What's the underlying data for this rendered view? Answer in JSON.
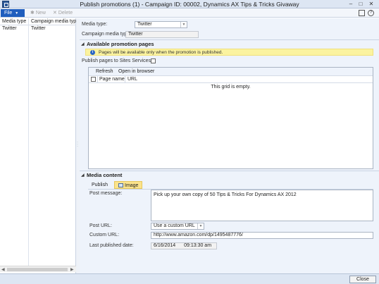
{
  "window": {
    "title": "Publish promotions (1) - Campaign ID: 00002, Dynamics AX Tips & Tricks Givaway",
    "min_glyph": "–",
    "max_glyph": "□",
    "close_glyph": "✕"
  },
  "toolbar": {
    "file_label": "File",
    "new_label": "New",
    "delete_label": "Delete",
    "help_glyph": "?"
  },
  "list": {
    "columns": [
      "Media type",
      "Campaign media type"
    ],
    "rows": [
      [
        "Twitter",
        "Twitter"
      ]
    ]
  },
  "form": {
    "media_type_label": "Media type:",
    "media_type_value": "Twitter",
    "campaign_media_type_label": "Campaign media type:",
    "campaign_media_type_value": "Twitter"
  },
  "promotion_pages": {
    "title": "Available promotion pages",
    "info_message": "Pages will be available only when the promotion is published.",
    "publish_to_sites_label": "Publish pages to Sites Services:",
    "publish_to_sites_checked": false,
    "refresh_label": "Refresh",
    "open_browser_label": "Open in browser",
    "grid_columns": [
      "Page name",
      "URL"
    ],
    "empty_message": "This grid is empty."
  },
  "media_content": {
    "title": "Media content",
    "tabs": [
      "Publish",
      "Image"
    ],
    "active_tab": "Image",
    "post_message_label": "Post message:",
    "post_message_value": "Pick up your own copy of 50 Tips & Tricks For Dynamics AX 2012",
    "post_url_label": "Post URL:",
    "post_url_value": "Use a custom URL",
    "custom_url_label": "Custom URL:",
    "custom_url_value": "http://www.amazon.com/dp/1495487776/",
    "last_published_label": "Last published date:",
    "last_published_date": "6/16/2014",
    "last_published_time": "09:13:30 am"
  },
  "footer": {
    "close_label": "Close"
  },
  "colors": {
    "file_button": "#1f5ebe",
    "info_bar": "#fbf3a0",
    "active_tab": "#fbe38c",
    "pane_background": "#eef3fb"
  }
}
